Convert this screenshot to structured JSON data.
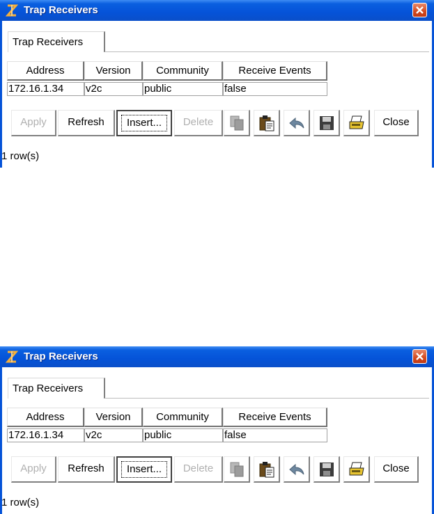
{
  "window": {
    "title": "Trap Receivers"
  },
  "tab": {
    "label": "Trap Receivers"
  },
  "table": {
    "columns": [
      "Address",
      "Version",
      "Community",
      "Receive Events"
    ],
    "rows": [
      [
        "172.16.1.34",
        "v2c",
        "public",
        "false"
      ]
    ]
  },
  "toolbar": {
    "apply": "Apply",
    "refresh": "Refresh",
    "insert": "Insert...",
    "delete": "Delete",
    "close": "Close"
  },
  "status": {
    "text": "1 row(s)"
  },
  "colors": {
    "title_bar": "#0553d8",
    "close_button": "#d2491f",
    "disabled_text": "#b0b0b0"
  },
  "icons": [
    "app-icon",
    "close-icon",
    "copy-icon",
    "paste-icon",
    "undo-icon",
    "save-icon",
    "print-icon"
  ]
}
